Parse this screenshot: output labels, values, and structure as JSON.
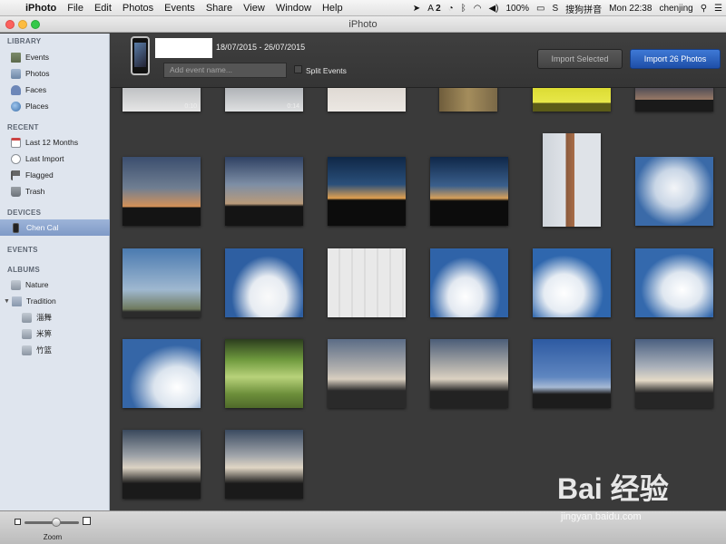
{
  "menubar": {
    "app_name": "iPhoto",
    "items": [
      "File",
      "Edit",
      "Photos",
      "Events",
      "Share",
      "View",
      "Window",
      "Help"
    ],
    "status": {
      "adobe": "2",
      "battery": "100%",
      "input_method": "搜狗拼音",
      "clock": "Mon 22:38",
      "user": "chenjing"
    }
  },
  "window": {
    "title": "iPhoto"
  },
  "sidebar": {
    "library_header": "LIBRARY",
    "library": [
      "Events",
      "Photos",
      "Faces",
      "Places"
    ],
    "recent_header": "RECENT",
    "recent": [
      "Last 12 Months",
      "Last Import",
      "Flagged",
      "Trash"
    ],
    "devices_header": "DEVICES",
    "devices": [
      "Chen Cal"
    ],
    "events_header": "EVENTS",
    "albums_header": "ALBUMS",
    "albums": [
      "Nature",
      "Tradition"
    ],
    "tradition_children": [
      "淄舞",
      "米箅",
      "竹篮"
    ]
  },
  "import": {
    "date_range": "18/07/2015 - 26/07/2015",
    "event_placeholder": "Add event name...",
    "split_label": "Split Events",
    "import_selected": "Import Selected",
    "import_all": "Import 26 Photos"
  },
  "grid": {
    "video_labels": [
      "0:10",
      "0:14"
    ]
  },
  "zoom": {
    "label": "Zoom",
    "level": 0.5
  },
  "watermark": {
    "brand": "Bai  经验",
    "url": "jingyan.baidu.com"
  },
  "colors": {
    "accent": "#1e4fa8",
    "sidebar_selected": "#7f9ac7",
    "content_bg": "#3a3a3a"
  }
}
